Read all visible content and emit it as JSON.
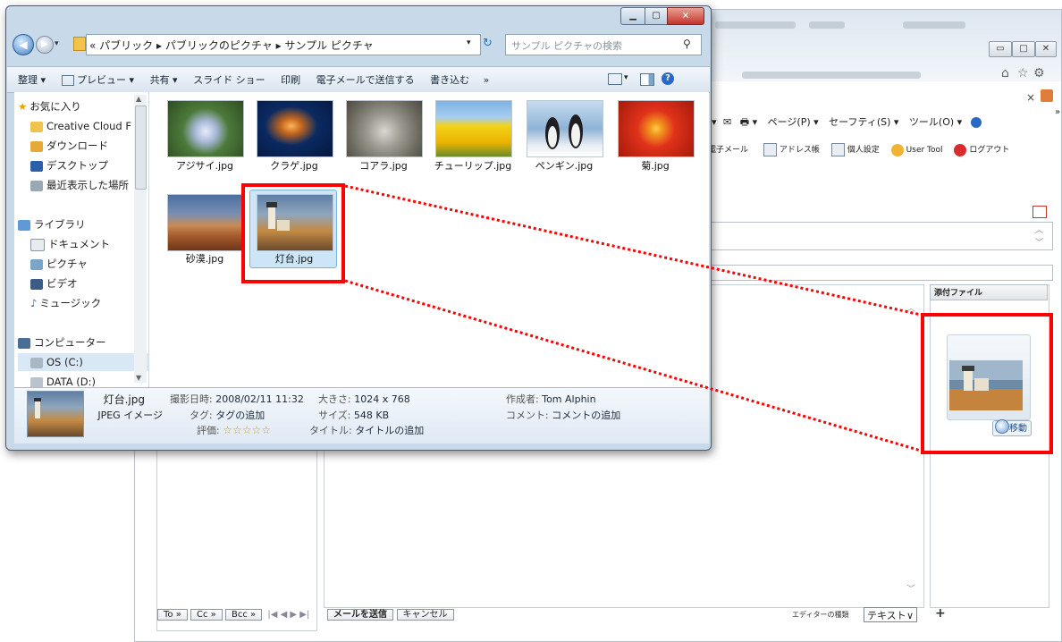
{
  "browser": {
    "menu": {
      "page": "ページ(P) ▾",
      "safety": "セーフティ(S) ▾",
      "tools": "ツール(O) ▾"
    },
    "toolbar": {
      "email": "電子メール",
      "address_book": "アドレス帳",
      "personal_settings": "個人設定",
      "user_tool": "User Tool",
      "logout": "ログアウト"
    },
    "attach": {
      "header": "添付ファイル",
      "move_button": "移動"
    },
    "bottom": {
      "to": "To »",
      "cc": "Cc »",
      "bcc": "Bcc »",
      "pager": "|◀ ◀ ▶ ▶|",
      "send": "メールを送信",
      "cancel": "キャンセル",
      "editor_type_label": "エディターの種類",
      "editor_type_value": "テキスト",
      "add": "+"
    }
  },
  "explorer": {
    "breadcrumb": {
      "prefix": "«",
      "segments": [
        "パブリック",
        "パブリックのピクチャ",
        "サンプル ピクチャ"
      ]
    },
    "search_placeholder": "サンプル ピクチャの検索",
    "commands": {
      "organize": "整理 ▾",
      "preview": "プレビュー ▾",
      "share": "共有 ▾",
      "slideshow": "スライド ショー",
      "print": "印刷",
      "email": "電子メールで送信する",
      "burn": "書き込む",
      "more": "»"
    },
    "nav": {
      "favorites": "お気に入り",
      "creative_cloud": "Creative Cloud F",
      "downloads": "ダウンロード",
      "desktop": "デスクトップ",
      "recent": "最近表示した場所",
      "libraries": "ライブラリ",
      "documents": "ドキュメント",
      "pictures": "ピクチャ",
      "videos": "ビデオ",
      "music": "ミュージック",
      "computer": "コンピューター",
      "os": "OS (C:)",
      "data": "DATA (D:)"
    },
    "files": [
      {
        "name": "アジサイ.jpg",
        "color": "#5a8a4a"
      },
      {
        "name": "クラゲ.jpg",
        "color": "#0b2c66"
      },
      {
        "name": "コアラ.jpg",
        "color": "#8d8d86"
      },
      {
        "name": "チューリップ.jpg",
        "color": "#e2b400"
      },
      {
        "name": "ペンギン.jpg",
        "color": "#6f9ac4"
      },
      {
        "name": "菊.jpg",
        "color": "#d8341a"
      },
      {
        "name": "砂漠.jpg",
        "color": "#b36a38"
      },
      {
        "name": "灯台.jpg",
        "color": "#5b6f86"
      }
    ],
    "details": {
      "filename": "灯台.jpg",
      "filetype": "JPEG イメージ",
      "date_taken_label": "撮影日時:",
      "date_taken": "2008/02/11 11:32",
      "tags_label": "タグ:",
      "tags": "タグの追加",
      "rating_label": "評価:",
      "rating": 0,
      "dimensions_label": "大きさ:",
      "dimensions": "1024 x 768",
      "size_label": "サイズ:",
      "size": "548 KB",
      "title_label": "タイトル:",
      "title": "タイトルの追加",
      "author_label": "作成者:",
      "author": "Tom Alphin",
      "comment_label": "コメント:",
      "comment": "コメントの追加"
    }
  },
  "colors": {
    "annotation": "#ff0000",
    "explorer_frame": "#c8d9ea",
    "selection": "#cde6f7"
  }
}
